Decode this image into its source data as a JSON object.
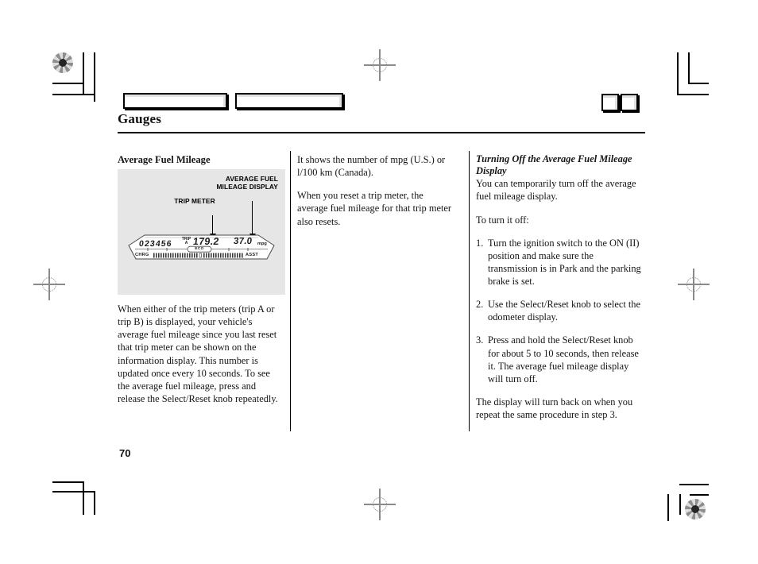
{
  "document": {
    "chapter_title": "Gauges",
    "page_number": "70"
  },
  "tabs": [
    {
      "name": "tab-box-left",
      "label": ""
    },
    {
      "name": "tab-box-right",
      "label": ""
    },
    {
      "name": "tab-marker-1",
      "label": ""
    },
    {
      "name": "tab-marker-2",
      "label": ""
    }
  ],
  "columns": {
    "left": {
      "heading": "Average Fuel Mileage",
      "body": "When either of the trip meters (trip A or trip B) is displayed, your vehicle's average fuel mileage since you last reset that trip meter can be shown on the information display. This number is updated once every 10 seconds. To see the average fuel mileage, press and release the Select/Reset knob repeatedly."
    },
    "middle": {
      "paragraphs": [
        "It shows the number of mpg (U.S.) or l/100 km (Canada).",
        "When you reset a trip meter, the average fuel mileage for that trip meter also resets."
      ]
    },
    "right": {
      "heading": "Turning Off the Average Fuel Mileage Display",
      "intro": "You can temporarily turn off the average fuel mileage display.",
      "lead_in": "To turn it off:",
      "steps": [
        {
          "num": "1.",
          "text": "Turn the ignition switch to the ON (II) position and make sure the transmission is in Park and the parking brake is set."
        },
        {
          "num": "2.",
          "text": "Use the Select/Reset knob to select the odometer display."
        },
        {
          "num": "3.",
          "text": "Press and hold the Select/Reset knob for about 5 to 10 seconds, then release it. The average fuel mileage display will turn off."
        }
      ],
      "closing": "The display will turn back on when you repeat the same procedure in step 3."
    }
  },
  "illustration": {
    "name": "instrument-cluster-illustration",
    "background_color": "#e6e6e6",
    "callouts": [
      {
        "name": "callout-average-fuel-mileage-display",
        "label": "AVERAGE FUEL\nMILEAGE DISPLAY"
      },
      {
        "name": "callout-trip-meter",
        "label": "TRIP METER"
      }
    ],
    "cluster_display": {
      "odometer": "023456",
      "trip_label_line1": "TRIP",
      "trip_label_line2": "A",
      "trip_value": "179.2",
      "fuel_economy_value": "37.0",
      "fuel_economy_unit": "mpg",
      "eco_badge": "ECO",
      "charge_label": "CHRG",
      "assist_label": "ASST"
    }
  }
}
